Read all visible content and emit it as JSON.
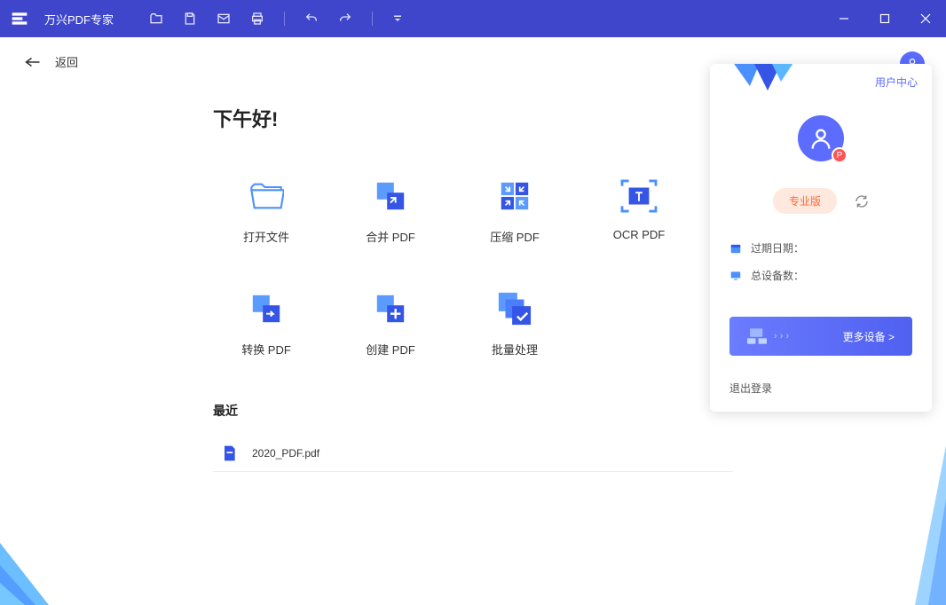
{
  "app": {
    "title": "万兴PDF专家"
  },
  "back": {
    "label": "返回"
  },
  "greeting": "下午好!",
  "features": [
    {
      "label": "打开文件"
    },
    {
      "label": "合并 PDF"
    },
    {
      "label": "压缩 PDF"
    },
    {
      "label": "OCR PDF"
    },
    {
      "label": "转换 PDF"
    },
    {
      "label": "创建 PDF"
    },
    {
      "label": "批量处理"
    }
  ],
  "recent": {
    "title": "最近",
    "files": [
      {
        "name": "2020_PDF.pdf"
      }
    ]
  },
  "user_panel": {
    "center_link": "用户中心",
    "avatar_badge": "P",
    "plan_label": "专业版",
    "expiry_label": "过期日期：",
    "devices_label": "总设备数：",
    "more_devices": "更多设备 >",
    "logout": "退出登录"
  }
}
